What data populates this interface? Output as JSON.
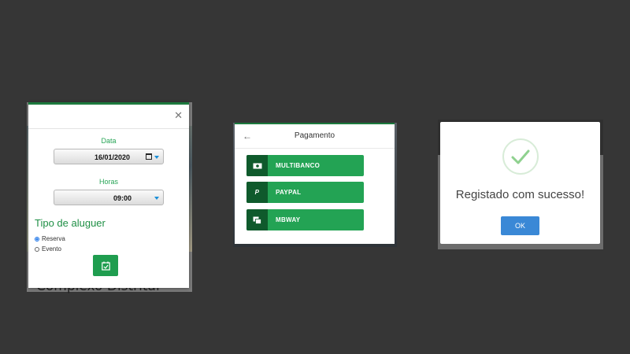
{
  "booking": {
    "background_text": "Complexo Distrital",
    "close_icon": "close-icon",
    "date": {
      "label": "Data",
      "value": "16/01/2020"
    },
    "hours": {
      "label": "Horas",
      "value": "09:00"
    },
    "type_title": "Tipo de aluguer",
    "options": [
      {
        "label": "Reserva",
        "checked": true
      },
      {
        "label": "Evento",
        "checked": false
      }
    ],
    "confirm_icon": "calendar-check-icon",
    "accent_color": "#1f9d4f"
  },
  "payment": {
    "title": "Pagamento",
    "back_icon": "arrow-left-icon",
    "methods": [
      {
        "label": "MULTIBANCO",
        "icon": "banknote-icon"
      },
      {
        "label": "PAYPAL",
        "icon": "paypal-icon"
      },
      {
        "label": "MBWAY",
        "icon": "mobile-payment-icon"
      }
    ],
    "button_color": "#23a354"
  },
  "success": {
    "message": "Registado com sucesso!",
    "ok_label": "OK",
    "icon": "checkmark-icon",
    "ok_color": "#3a88d6"
  }
}
